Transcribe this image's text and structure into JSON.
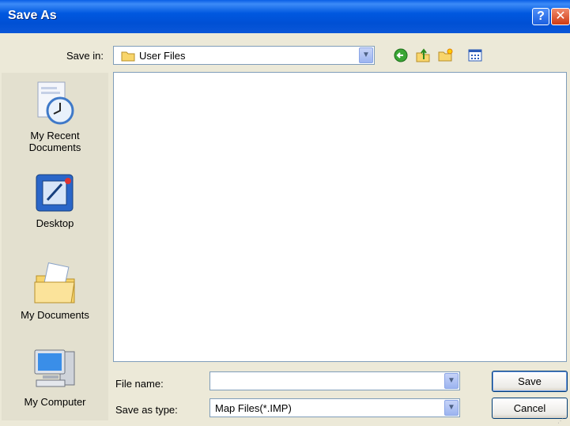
{
  "window": {
    "title": "Save As"
  },
  "titlebar": {
    "help_label": "?",
    "close_label": "✕"
  },
  "save_in": {
    "label": "Save in:",
    "value": "User Files"
  },
  "places": [
    {
      "label": "My Recent Documents",
      "line1": "My Recent",
      "line2": "Documents"
    },
    {
      "label": "Desktop"
    },
    {
      "label": "My Documents"
    },
    {
      "label": "My Computer"
    }
  ],
  "file_name": {
    "label": "File name:",
    "value": ""
  },
  "save_as_type": {
    "label": "Save as type:",
    "value": "Map Files(*.IMP)"
  },
  "buttons": {
    "save": "Save",
    "cancel": "Cancel"
  },
  "icons": {
    "back": "back-arrow-icon",
    "up": "up-folder-icon",
    "new_folder": "new-folder-icon",
    "views": "views-menu-icon"
  },
  "colors": {
    "titlebar": "#0058e0",
    "dialog_bg": "#ece9d8",
    "field_border": "#7f9db9"
  }
}
